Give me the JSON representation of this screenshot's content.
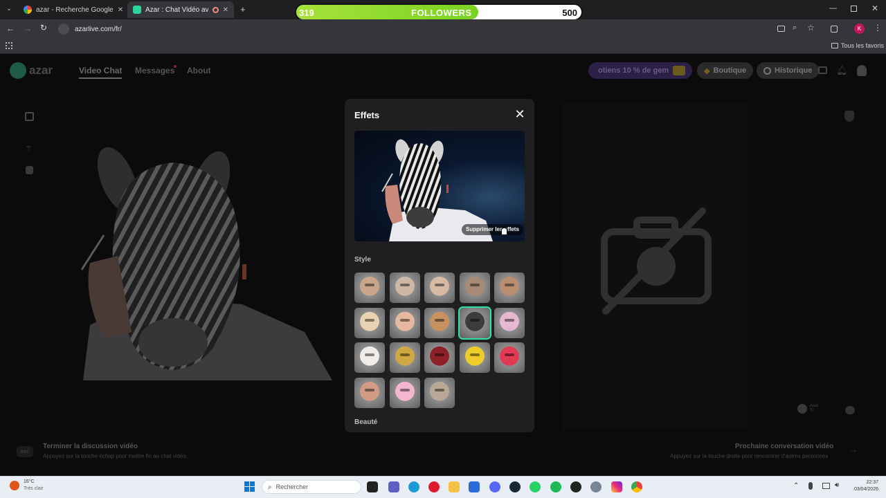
{
  "browser": {
    "tabs": [
      {
        "title": "azar - Recherche Google",
        "active": false
      },
      {
        "title": "Azar : Chat Vidéo avec de n",
        "active": true
      }
    ],
    "url": "azarlive.com/fr/",
    "bookmarks_label": "Tous les favoris"
  },
  "followers_bar": {
    "current": "319",
    "label": "FOLLOWERS",
    "goal": "500",
    "progress": 0.638
  },
  "app": {
    "logo": "azar",
    "nav": [
      "Video Chat",
      "Messages",
      "About"
    ],
    "promo": "otiens 10 % de gem",
    "shop": "Boutique",
    "history": "Historique"
  },
  "modal": {
    "title": "Effets",
    "remove_effects": "Supprimer les effets",
    "style_label": "Style",
    "beauty_label": "Beauté",
    "selected_index": 8,
    "effects": [
      {
        "icon": "face-man-1-icon",
        "color": "#c9a58c"
      },
      {
        "icon": "face-bigeyes-icon",
        "color": "#cdb8a6"
      },
      {
        "icon": "face-smile-icon",
        "color": "#d7b9a4"
      },
      {
        "icon": "face-man-2-icon",
        "color": "#a88a74"
      },
      {
        "icon": "face-man-3-icon",
        "color": "#b98e70"
      },
      {
        "icon": "face-white-mask-icon",
        "color": "#e9d2b1"
      },
      {
        "icon": "face-woman-icon",
        "color": "#e4b9a0"
      },
      {
        "icon": "face-bear-icon",
        "color": "#c7925f"
      },
      {
        "icon": "face-zebra-icon",
        "color": "#3a3c3d"
      },
      {
        "icon": "face-cartoon-pink-icon",
        "color": "#e6b7d1"
      },
      {
        "icon": "face-cartoon-eyes-icon",
        "color": "#f1ece7"
      },
      {
        "icon": "face-banana-icon",
        "color": "#cfa844"
      },
      {
        "icon": "face-sunglasses-icon",
        "color": "#8e2027"
      },
      {
        "icon": "face-yellow-mask-icon",
        "color": "#f0cc2a"
      },
      {
        "icon": "face-heart-icon",
        "color": "#e03a55"
      },
      {
        "icon": "face-woman-2-icon",
        "color": "#d39b86"
      },
      {
        "icon": "face-bunny-icon",
        "color": "#f2b6cf"
      },
      {
        "icon": "face-glasses-icon",
        "color": "#b9a896"
      }
    ]
  },
  "hints": {
    "left_key": "esc",
    "left_title": "Terminer la discussion vidéo",
    "left_sub": "Appuyez sur la touche échap pour mettre fin au chat vidéo.",
    "right_title": "Prochaine conversation vidéo",
    "right_sub": "Appuyez sur la touche droite pour rencontrer d'autres personnes"
  },
  "right_pane": {
    "partner_name": "Asia",
    "partner_sub": "Ti"
  },
  "taskbar": {
    "weather_temp": "16°C",
    "weather_desc": "Très clair",
    "search_placeholder": "Rechercher",
    "time": "22:37",
    "date": "03/04/2026"
  }
}
